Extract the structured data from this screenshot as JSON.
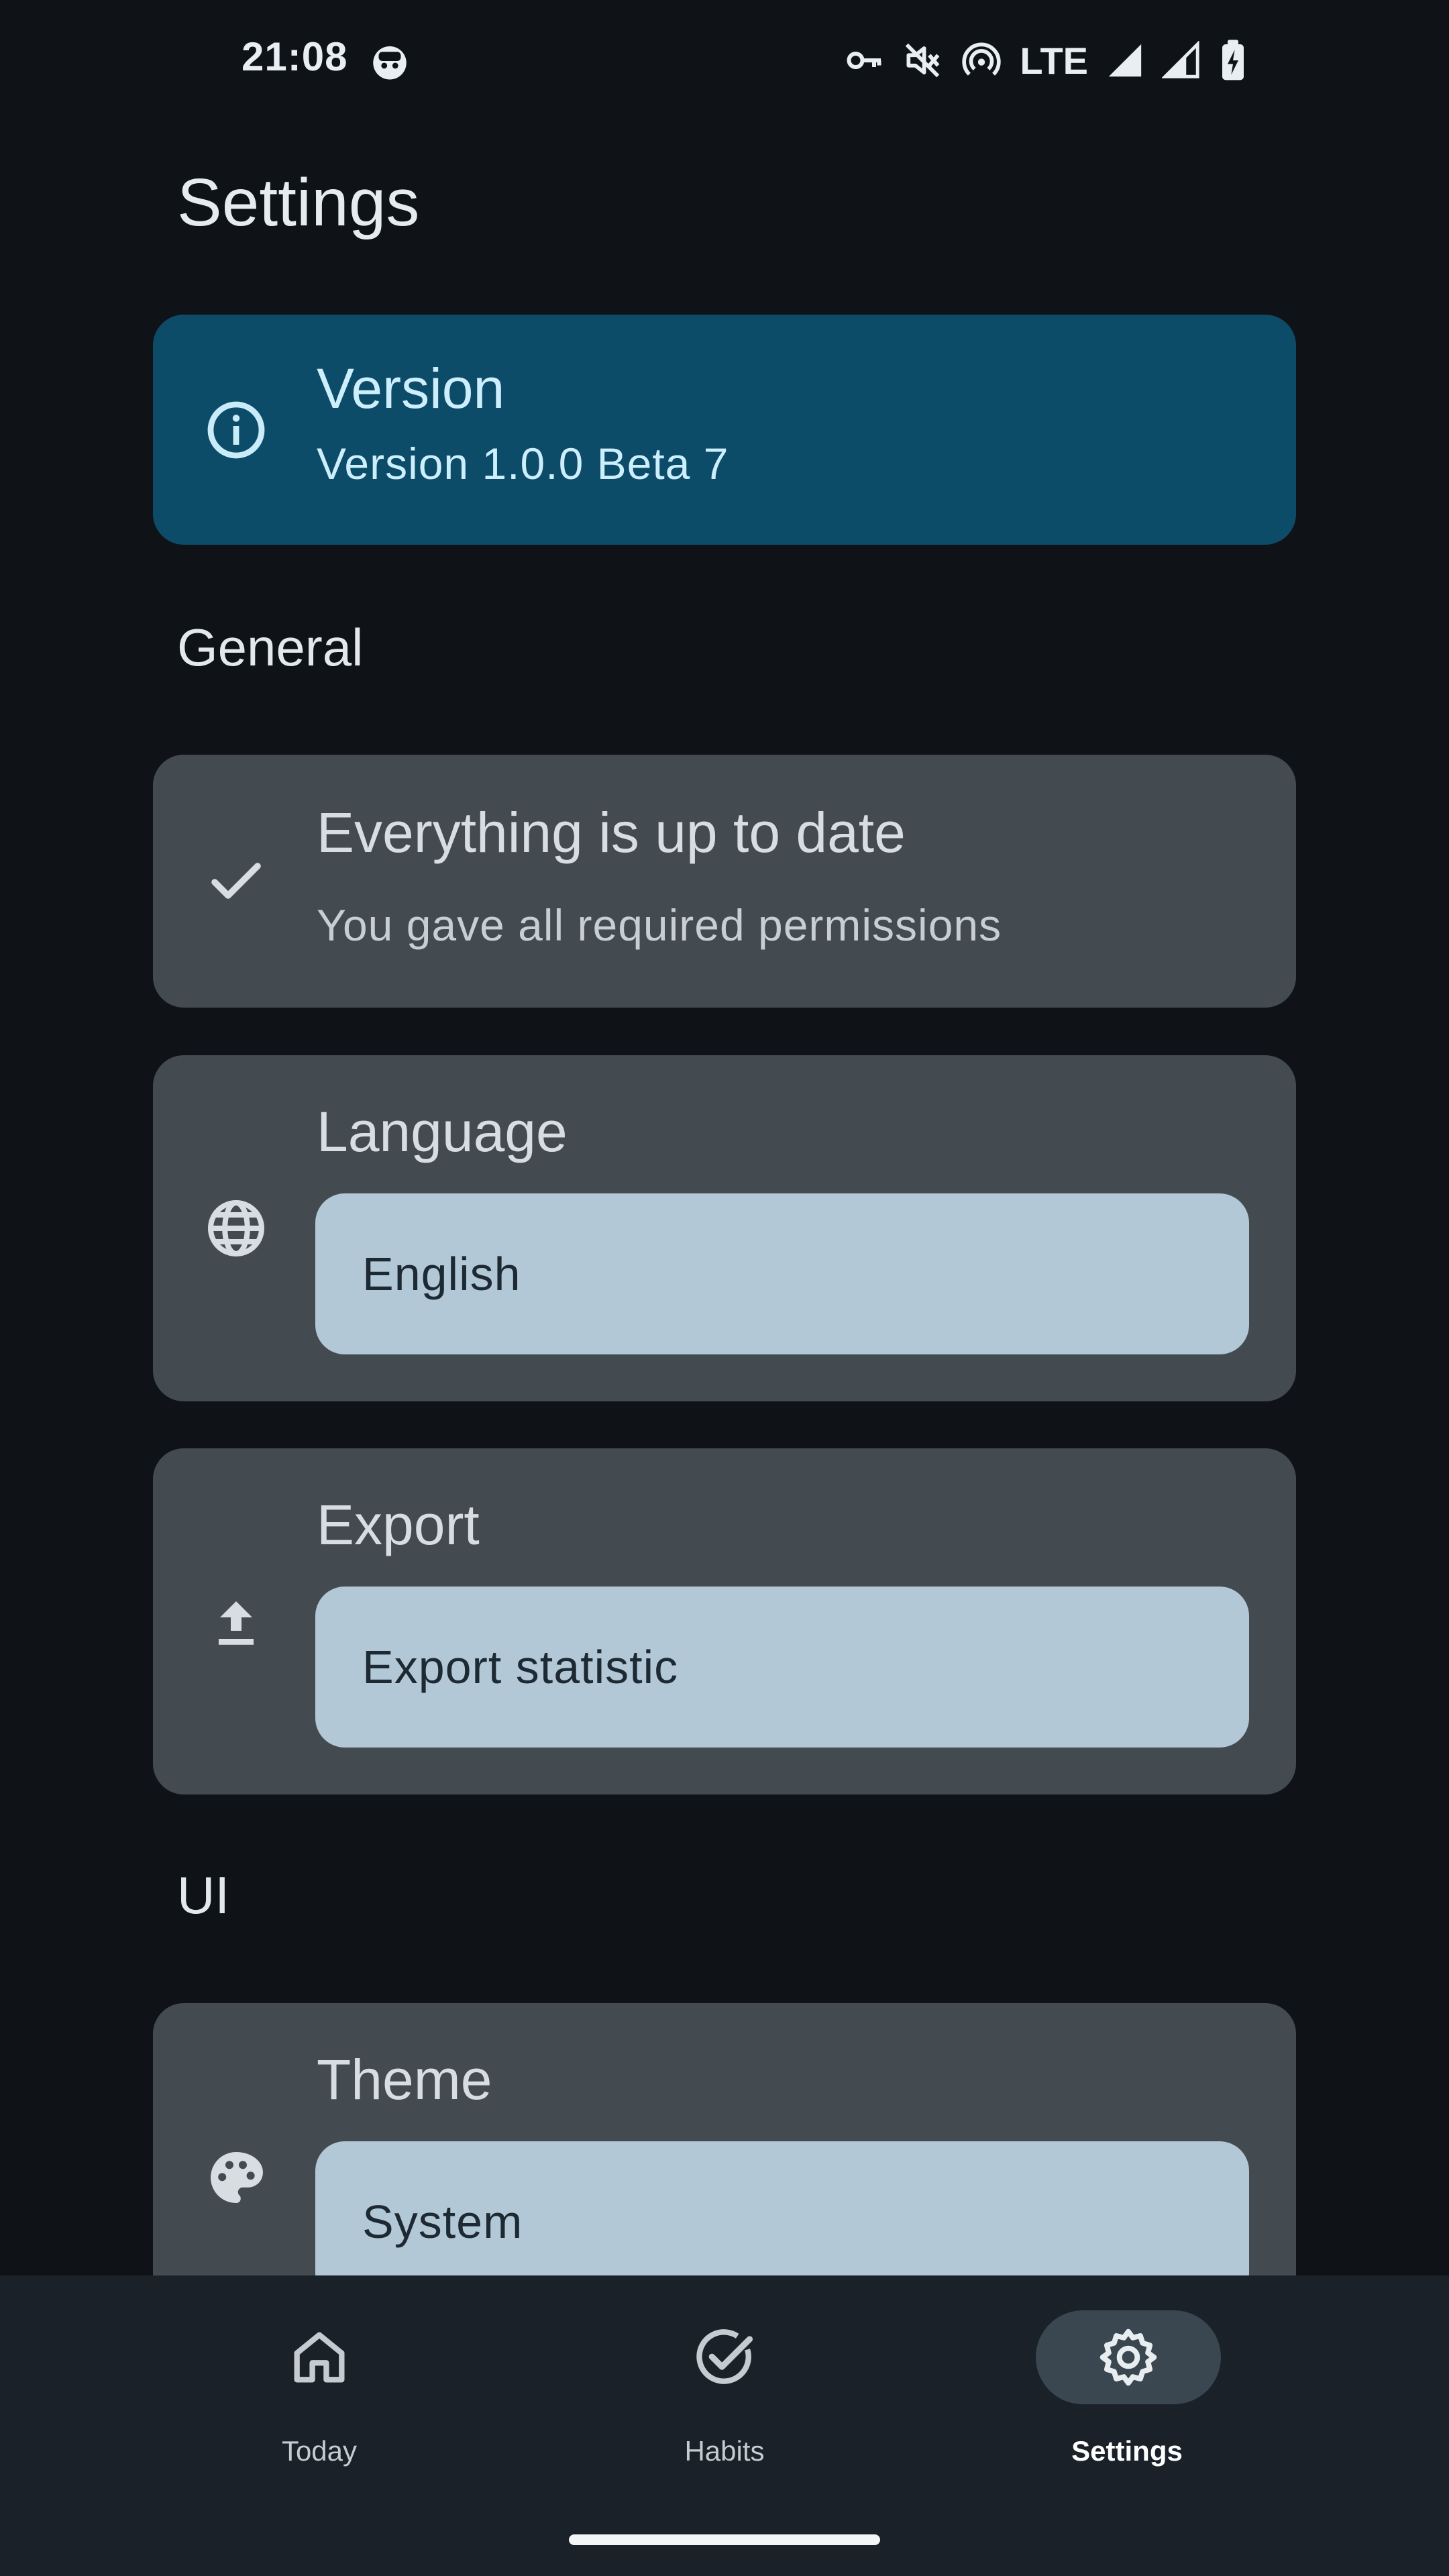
{
  "status_bar": {
    "time": "21:08",
    "network": "LTE",
    "icons": [
      "vpn-key-icon",
      "mute-icon",
      "hotspot-icon",
      "signal-icon",
      "signal-icon",
      "battery-charging-icon"
    ]
  },
  "page": {
    "title": "Settings"
  },
  "version_card": {
    "icon": "info-icon",
    "title": "Version",
    "subtitle": "Version 1.0.0 Beta 7"
  },
  "general": {
    "label": "General",
    "status_card": {
      "icon": "check-icon",
      "title": "Everything is up to date",
      "subtitle": "You gave all required permissions"
    },
    "language_card": {
      "icon": "globe-icon",
      "title": "Language",
      "value": "English"
    },
    "export_card": {
      "icon": "upload-icon",
      "title": "Export",
      "button_label": "Export statistic"
    }
  },
  "ui": {
    "label": "UI",
    "theme_card": {
      "icon": "palette-icon",
      "title": "Theme",
      "value": "System"
    }
  },
  "bottom_nav": {
    "items": [
      {
        "label": "Today",
        "icon": "home-icon",
        "active": false
      },
      {
        "label": "Habits",
        "icon": "check-circle-icon",
        "active": false
      },
      {
        "label": "Settings",
        "icon": "gear-icon",
        "active": true
      }
    ]
  },
  "colors": {
    "background": "#0f1318",
    "version_card": "#0d4c68",
    "card": "#444b50",
    "field": "#b3c8d7",
    "nav_background": "#1b2129",
    "nav_active_pill": "#3a4650"
  }
}
